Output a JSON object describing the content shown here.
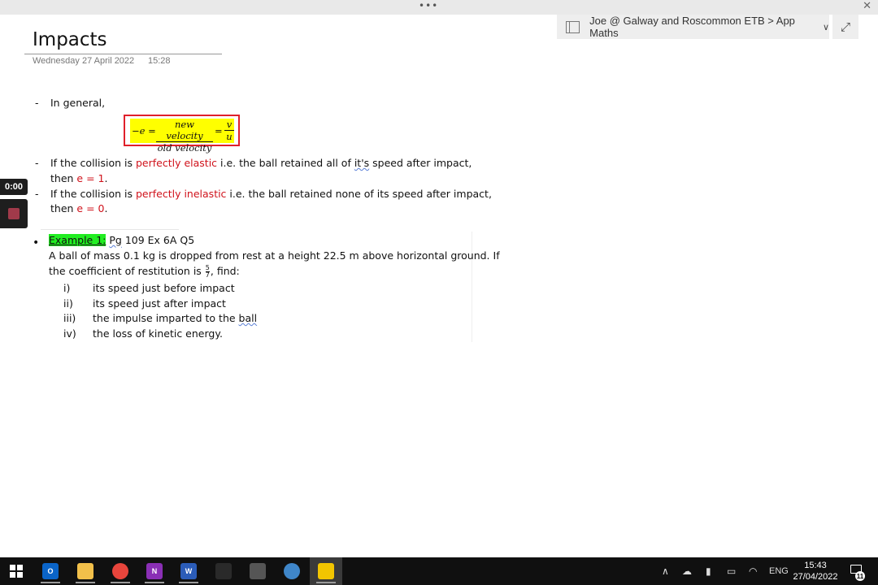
{
  "window": {
    "menu_dots": "•••",
    "close_glyph": "✕"
  },
  "breadcrumb": {
    "text": "Joe @ Galway and Roscommon ETB > App Maths",
    "chevron": "∨",
    "expand_glyph": "⤢"
  },
  "page": {
    "title": "Impacts",
    "date": "Wednesday 27 April 2022",
    "time": "15:28"
  },
  "recorder": {
    "timer": "0:00",
    "stop_color": "#a13a4a"
  },
  "notes": {
    "dash_symbol": "-",
    "in_general": "In general,",
    "formula": {
      "lhs": "−e =",
      "frac1_num": "new velocity",
      "frac1_den": "old velocity",
      "eq2": "=",
      "frac2_num": "v",
      "frac2_den": "u"
    },
    "elastic": {
      "prefix": "If the collision is ",
      "term": "perfectly elastic",
      "mid": " i.e. the ball retained all of ",
      "word_its": "it's",
      "suffix": " speed after impact,",
      "line2_prefix": "then ",
      "value": "e = 1",
      "end": "."
    },
    "inelastic": {
      "prefix": "If the collision is ",
      "term": "perfectly inelastic",
      "suffix": " i.e. the ball retained none of its speed after impact,",
      "line2_prefix": "then ",
      "value": "e = 0",
      "end": "."
    },
    "example": {
      "bullet": "•",
      "label": "Example 1:",
      "ref_pg": "Pg",
      "ref_rest": " 109 Ex 6A Q5",
      "line1": "A ball of mass 0.1 kg is dropped from rest at a height 22.5 m above horizontal ground. If",
      "line2_prefix": "the coefficient of restitution is ",
      "frac_num": "5",
      "frac_den": "7",
      "line2_suffix": ", find:",
      "items": [
        {
          "num": "i)",
          "text": "its speed just before impact"
        },
        {
          "num": "ii)",
          "text": "its speed just after impact"
        },
        {
          "num": "iii)",
          "text_prefix": "the impulse imparted to the ",
          "text_squiggle": "ball"
        },
        {
          "num": "iv)",
          "text": "the loss of kinetic energy."
        }
      ]
    }
  },
  "taskbar": {
    "apps": [
      {
        "name": "outlook",
        "label": "O",
        "color": "#0a64c8"
      },
      {
        "name": "file-explorer",
        "label": "",
        "color": "#f2c04a"
      },
      {
        "name": "chrome",
        "label": "",
        "color": "#e8453c"
      },
      {
        "name": "onenote",
        "label": "N",
        "color": "#8a2fb5"
      },
      {
        "name": "word",
        "label": "W",
        "color": "#2b5cb8"
      },
      {
        "name": "calculator-dark",
        "label": "",
        "color": "#2a2a2a"
      },
      {
        "name": "calculator",
        "label": "",
        "color": "#555555"
      },
      {
        "name": "recorder",
        "label": "",
        "color": "#3f86c9"
      },
      {
        "name": "sticky-notes",
        "label": "",
        "color": "#f2c500"
      }
    ],
    "system": {
      "chevron": "∧",
      "cloud": "☁",
      "mic": "▮",
      "battery": "▭",
      "wifi": "◠",
      "language": "ENG"
    },
    "clock_time": "15:43",
    "clock_date": "27/04/2022",
    "notification_count": "11"
  }
}
